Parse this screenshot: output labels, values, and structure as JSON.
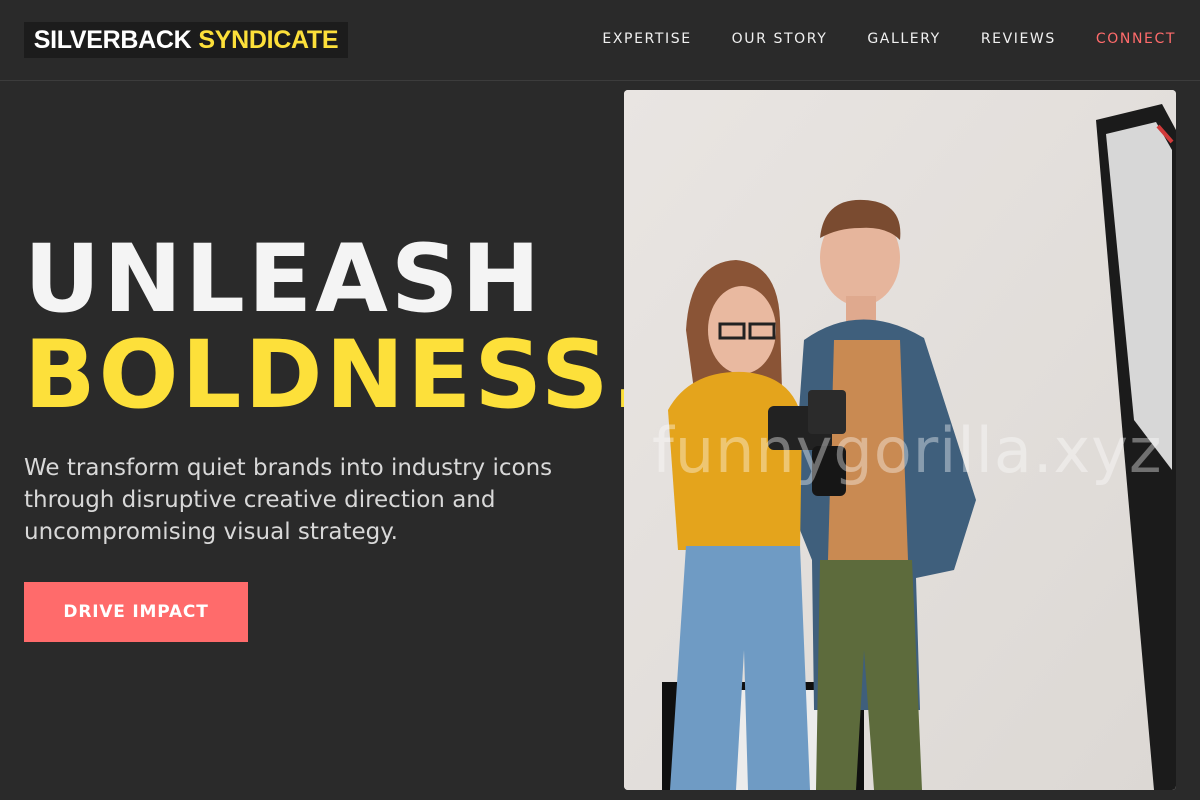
{
  "brand": {
    "part1": "SILVERBACK",
    "part2": "SYNDICATE"
  },
  "nav": [
    "EXPERTISE",
    "OUR STORY",
    "GALLERY",
    "REVIEWS",
    "CONNECT"
  ],
  "hero": {
    "title_line1": "UNLEASH",
    "title_line2": "BOLDNESS.",
    "description": "We transform quiet brands into industry icons through disruptive creative direction and uncompromising visual strategy.",
    "cta_label": "DRIVE IMPACT"
  },
  "image": {
    "alt": "Two people reviewing photos on a camera in a studio",
    "watermark": "funnygorilla.xyz"
  },
  "colors": {
    "background": "#2a2a2a",
    "accent_yellow": "#fde03a",
    "accent_coral": "#ff6b6b"
  }
}
